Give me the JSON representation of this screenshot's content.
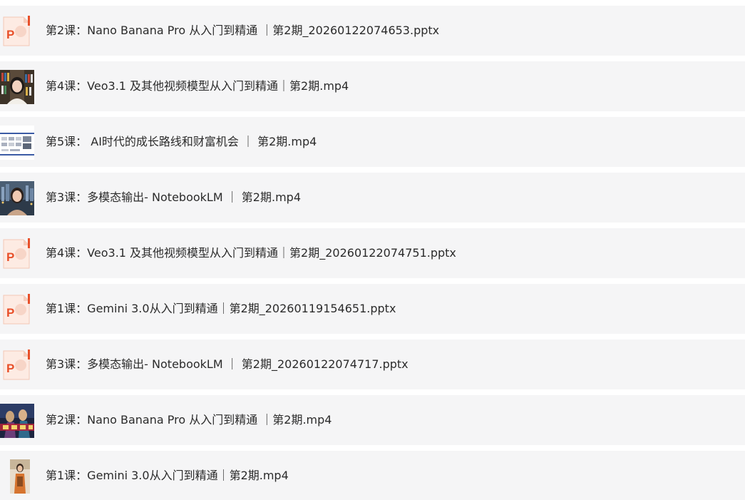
{
  "files": [
    {
      "label": "第2课：Nano Banana Pro 从入门到精通 ｜第2期_20260122074653.pptx",
      "icon": "ppt-file-icon"
    },
    {
      "label": "第4课：Veo3.1 及其他视频模型从入门到精通｜第2期.mp4",
      "icon": "video-thumbnail-woman-bookshelf"
    },
    {
      "label": "第5课： AI时代的成长路线和财富机会 ｜ 第2期.mp4",
      "icon": "video-thumbnail-slides"
    },
    {
      "label": "第3课：多模态输出- NotebookLM ｜ 第2期.mp4",
      "icon": "video-thumbnail-woman-city"
    },
    {
      "label": "第4课：Veo3.1 及其他视频模型从入门到精通｜第2期_20260122074751.pptx",
      "icon": "ppt-file-icon"
    },
    {
      "label": "第1课：Gemini 3.0从入门到精通｜第2期_20260119154651.pptx",
      "icon": "ppt-file-icon"
    },
    {
      "label": "第3课：多模态输出- NotebookLM ｜ 第2期_20260122074717.pptx",
      "icon": "ppt-file-icon"
    },
    {
      "label": "第2课：Nano Banana Pro 从入门到精通 ｜第2期.mp4",
      "icon": "video-thumbnail-poster"
    },
    {
      "label": "第1课：Gemini 3.0从入门到精通｜第2期.mp4",
      "icon": "video-thumbnail-figure"
    }
  ],
  "colors": {
    "row_bg": "#f5f5f6",
    "text": "#2b2b2b",
    "ppt_accent": "#e8502a"
  }
}
